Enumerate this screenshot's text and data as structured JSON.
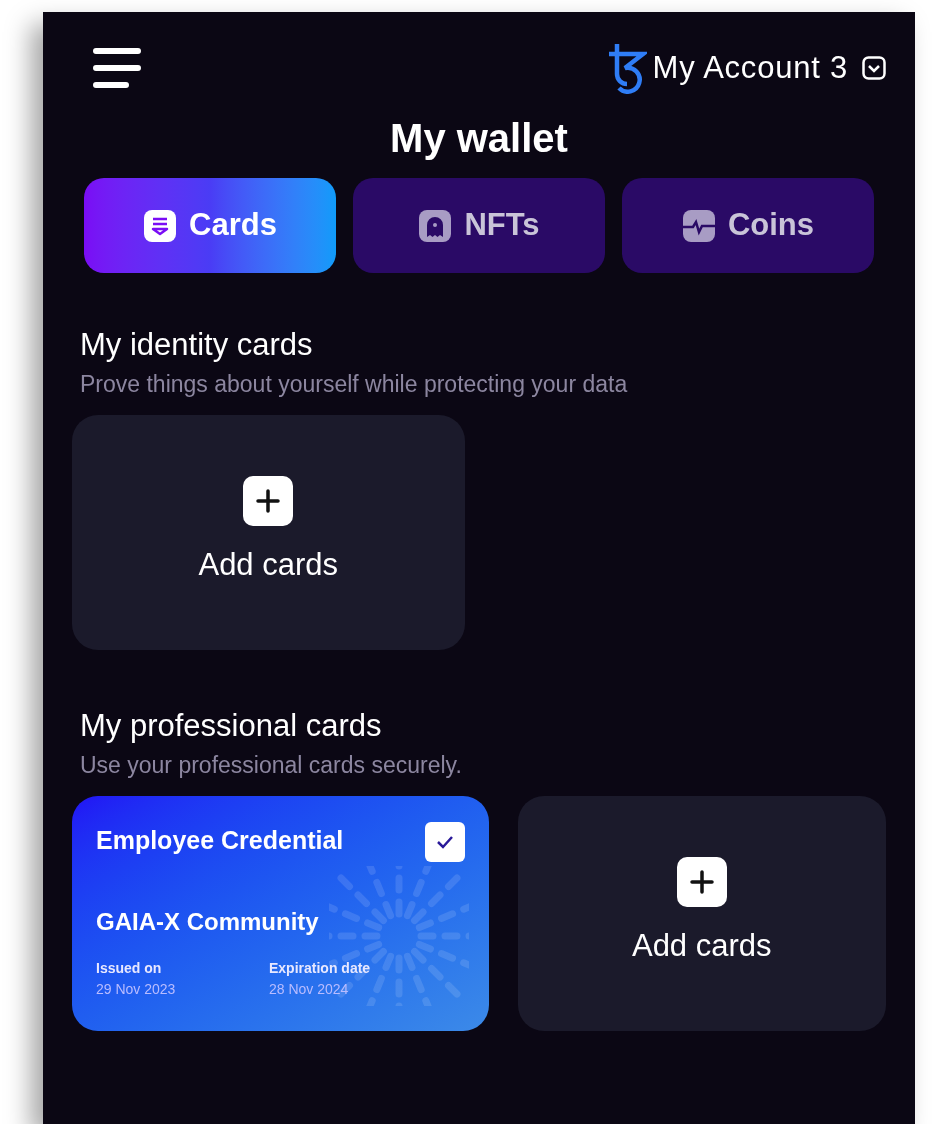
{
  "header": {
    "account": "My Account 3"
  },
  "title": "My wallet",
  "tabs": [
    {
      "label": "Cards",
      "selected": true
    },
    {
      "label": "NFTs",
      "selected": false
    },
    {
      "label": "Coins",
      "selected": false
    }
  ],
  "sections": [
    {
      "title": "My identity cards",
      "subtitle": "Prove things about yourself while protecting your data",
      "cards": [
        {
          "kind": "add",
          "label": "Add cards"
        }
      ]
    },
    {
      "title": "My professional cards",
      "subtitle": "Use your professional cards securely.",
      "cards": [
        {
          "kind": "credential",
          "name": "Employee Credential",
          "checked": true,
          "issuer": "GAIA-X Community",
          "issued_label": "Issued on",
          "issued": "29 Nov 2023",
          "expiry_label": "Expiration date",
          "expiry": "28 Nov 2024"
        },
        {
          "kind": "add",
          "label": "Add cards"
        }
      ]
    }
  ]
}
